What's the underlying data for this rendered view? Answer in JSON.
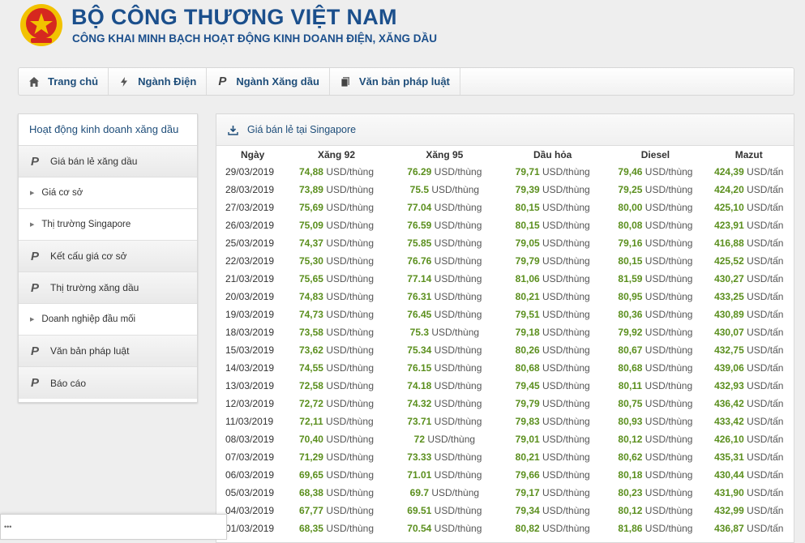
{
  "header": {
    "title": "BỘ CÔNG THƯƠNG VIỆT NAM",
    "subtitle": "CÔNG KHAI MINH BẠCH HOẠT ĐỘNG KINH DOANH ĐIỆN, XĂNG DẦU"
  },
  "nav": [
    {
      "label": "Trang chủ",
      "icon": "home-icon"
    },
    {
      "label": "Ngành Điện",
      "icon": "bolt-icon"
    },
    {
      "label": "Ngành Xăng dầu",
      "icon": "p-icon"
    },
    {
      "label": "Văn bản pháp luật",
      "icon": "document-icon"
    }
  ],
  "sidebar": {
    "heading": "Hoạt động kinh doanh xăng dầu",
    "items": [
      {
        "label": "Giá bán lẻ xăng dầu",
        "kind": "major"
      },
      {
        "label": "Giá cơ sở",
        "kind": "minor"
      },
      {
        "label": "Thị trường Singapore",
        "kind": "minor"
      },
      {
        "label": "Kết cấu giá cơ sở",
        "kind": "major"
      },
      {
        "label": "Thị trường xăng dầu",
        "kind": "major"
      },
      {
        "label": "Doanh nghiệp đầu mối",
        "kind": "minor"
      },
      {
        "label": "Văn bản pháp luật",
        "kind": "major"
      },
      {
        "label": "Báo cáo",
        "kind": "major"
      }
    ]
  },
  "panel": {
    "title": "Giá bán lẻ tại Singapore",
    "columns": [
      "Ngày",
      "Xăng 92",
      "Xăng 95",
      "Dầu hỏa",
      "Diesel",
      "Mazut"
    ],
    "unit_barrel": "USD/thùng",
    "unit_ton": "USD/tấn",
    "rows": [
      [
        "29/03/2019",
        "74,88",
        "76.29",
        "79,71",
        "79,46",
        "424,39"
      ],
      [
        "28/03/2019",
        "73,89",
        "75.5",
        "79,39",
        "79,25",
        "424,20"
      ],
      [
        "27/03/2019",
        "75,69",
        "77.04",
        "80,15",
        "80,00",
        "425,10"
      ],
      [
        "26/03/2019",
        "75,09",
        "76.59",
        "80,15",
        "80,08",
        "423,91"
      ],
      [
        "25/03/2019",
        "74,37",
        "75.85",
        "79,05",
        "79,16",
        "416,88"
      ],
      [
        "22/03/2019",
        "75,30",
        "76.76",
        "79,79",
        "80,15",
        "425,52"
      ],
      [
        "21/03/2019",
        "75,65",
        "77.14",
        "81,06",
        "81,59",
        "430,27"
      ],
      [
        "20/03/2019",
        "74,83",
        "76.31",
        "80,21",
        "80,95",
        "433,25"
      ],
      [
        "19/03/2019",
        "74,73",
        "76.45",
        "79,51",
        "80,36",
        "430,89"
      ],
      [
        "18/03/2019",
        "73,58",
        "75.3",
        "79,18",
        "79,92",
        "430,07"
      ],
      [
        "15/03/2019",
        "73,62",
        "75.34",
        "80,26",
        "80,67",
        "432,75"
      ],
      [
        "14/03/2019",
        "74,55",
        "76.15",
        "80,68",
        "80,68",
        "439,06"
      ],
      [
        "13/03/2019",
        "72,58",
        "74.18",
        "79,45",
        "80,11",
        "432,93"
      ],
      [
        "12/03/2019",
        "72,72",
        "74.32",
        "79,79",
        "80,75",
        "436,42"
      ],
      [
        "11/03/2019",
        "72,11",
        "73.71",
        "79,83",
        "80,93",
        "433,42"
      ],
      [
        "08/03/2019",
        "70,40",
        "72",
        "79,01",
        "80,12",
        "426,10"
      ],
      [
        "07/03/2019",
        "71,29",
        "73.33",
        "80,21",
        "80,62",
        "435,31"
      ],
      [
        "06/03/2019",
        "69,65",
        "71.01",
        "79,66",
        "80,18",
        "430,44"
      ],
      [
        "05/03/2019",
        "68,38",
        "69.7",
        "79,17",
        "80,23",
        "431,90"
      ],
      [
        "04/03/2019",
        "67,77",
        "69.51",
        "79,34",
        "80,12",
        "432,99"
      ],
      [
        "01/03/2019",
        "68,35",
        "70.54",
        "80,82",
        "81,86",
        "436,87"
      ]
    ]
  },
  "colors": {
    "brand": "#1b4f8c",
    "price": "#5b8f1e",
    "emblem_red": "#d6281f",
    "emblem_gold": "#f2c200"
  }
}
